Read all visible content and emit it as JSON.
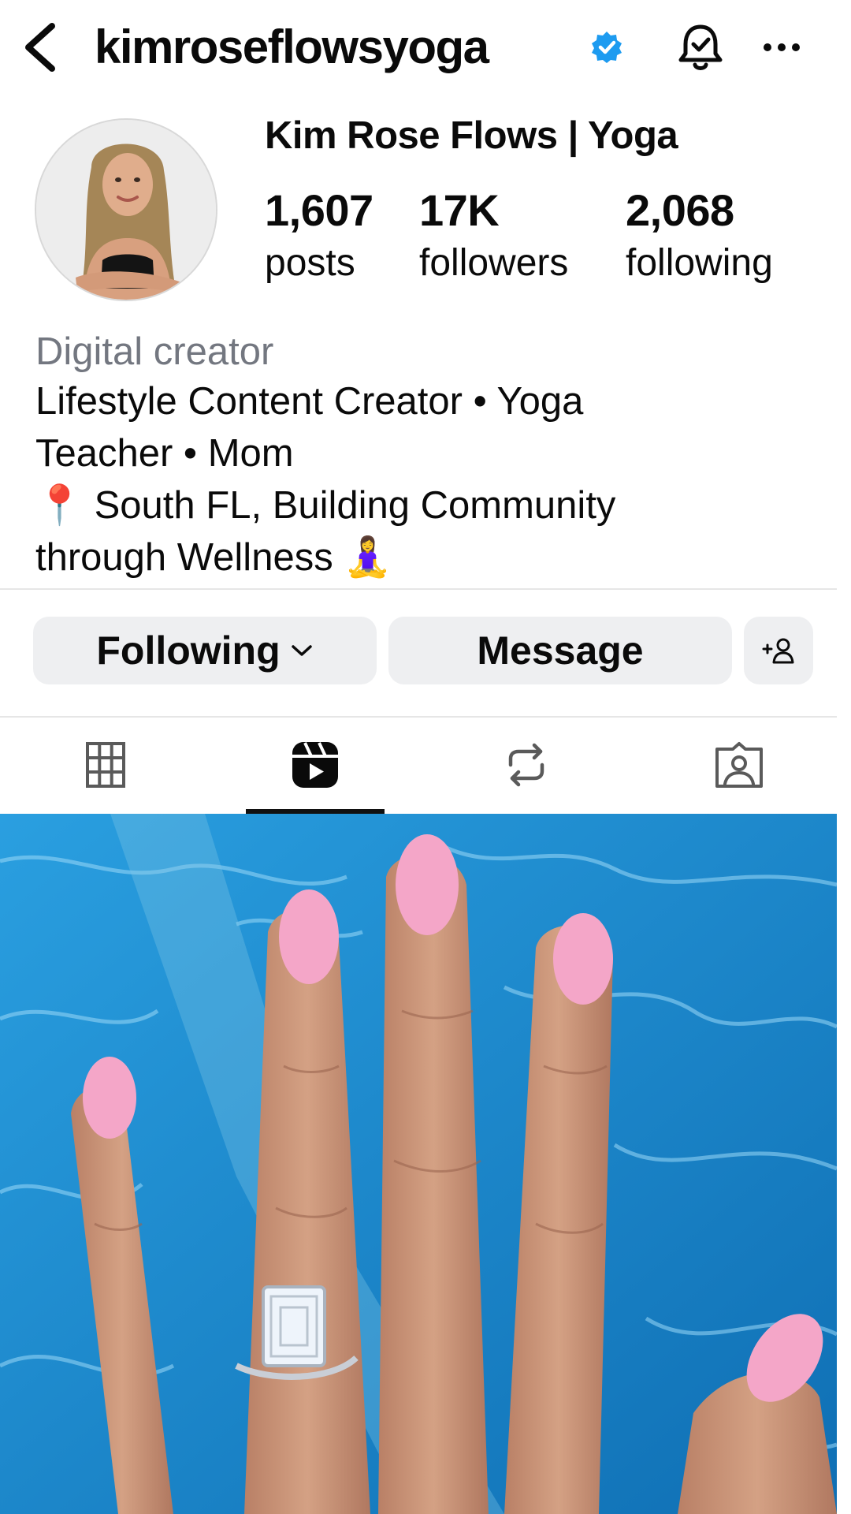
{
  "header": {
    "username": "kimroseflowsyoga",
    "back_icon": "chevron-left-icon",
    "verified_icon": "verified-badge-icon",
    "bell_icon": "bell-check-icon",
    "more_icon": "more-horizontal-icon",
    "verified_color": "#1d9bf0"
  },
  "profile": {
    "display_name": "Kim Rose Flows | Yoga",
    "avatar": "profile-photo",
    "stats": [
      {
        "value": "1,607",
        "label": "posts"
      },
      {
        "value": "17K",
        "label": "followers"
      },
      {
        "value": "2,068",
        "label": "following"
      }
    ],
    "category": "Digital creator",
    "bio_lines": [
      "Lifestyle Content Creator • Yoga",
      "Teacher • Mom",
      "📍 South FL, Building Community",
      "through Wellness 🧘‍♀️"
    ]
  },
  "actions": {
    "following_label": "Following",
    "message_label": "Message",
    "suggest_icon": "add-person-icon"
  },
  "tabs": [
    {
      "name": "grid",
      "icon": "grid-icon",
      "active": false
    },
    {
      "name": "reels",
      "icon": "reels-icon",
      "active": true
    },
    {
      "name": "reposts",
      "icon": "repost-icon",
      "active": false
    },
    {
      "name": "tagged",
      "icon": "tagged-icon",
      "active": false
    }
  ],
  "colors": {
    "text": "#0a0a0a",
    "muted": "#737780",
    "button_bg": "#eeeff1",
    "pool_blue": "#1e8fd0",
    "nail_pink": "#f4a6c8"
  }
}
